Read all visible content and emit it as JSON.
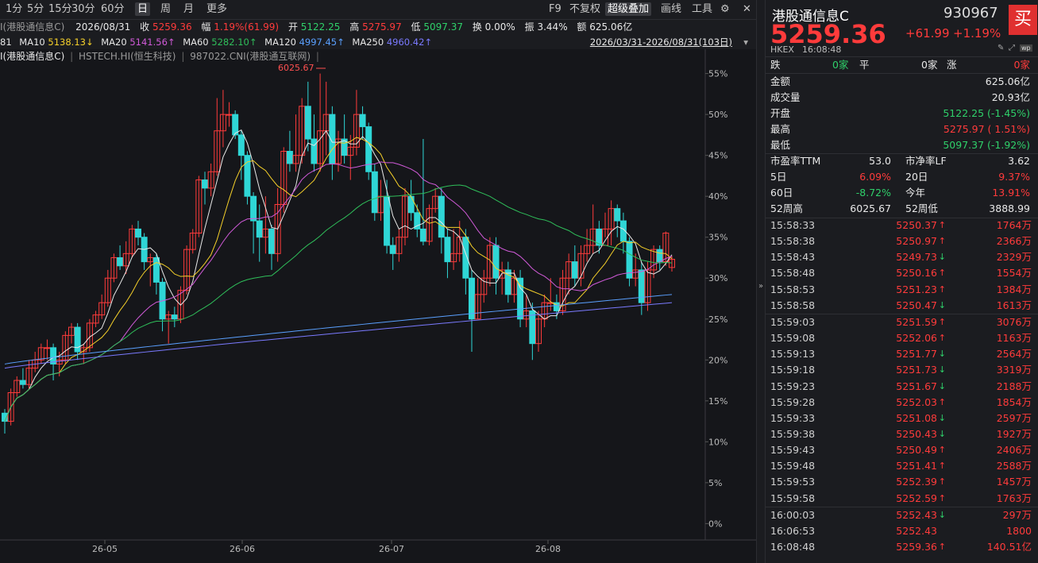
{
  "toolbar": {
    "left": [
      "1分",
      "5分",
      "15分",
      "30分",
      "60分",
      "日",
      "周",
      "月",
      "更多"
    ],
    "active_index": 5,
    "right": [
      "F9",
      "不复权",
      "超级叠加",
      "画线",
      "工具"
    ],
    "right_active_index": 2
  },
  "info": {
    "date": "2026/08/31",
    "close_label": "收",
    "close": "5259.36",
    "amp_label": "幅",
    "amp": "1.19%(61.99)",
    "open_label": "开",
    "open": "5122.25",
    "high_label": "高",
    "high": "5275.97",
    "low_label": "低",
    "low": "5097.37",
    "turnover_label": "换",
    "turnover": "0.00%",
    "swing_label": "振",
    "swing": "3.44%",
    "amount_label": "额",
    "amount": "625.06亿",
    "title_fragment": "I(港股通信息C)"
  },
  "ma": {
    "ma5_frag": "81",
    "ma10_label": "MA10",
    "ma10": "5138.13",
    "ma20_label": "MA20",
    "ma20": "5141.56",
    "ma60_label": "MA60",
    "ma60": "5282.10",
    "ma120_label": "MA120",
    "ma120": "4997.45",
    "ma250_label": "MA250",
    "ma250": "4960.42",
    "range": "2026/03/31-2026/08/31(103日)"
  },
  "overlay": {
    "main": "I(港股通信息C)",
    "s2": "HSTECH.HI(恒生科技)",
    "s3": "987022.CNI(港股通互联网)"
  },
  "colors": {
    "up": "#ff3b3b",
    "down": "#2fd6d6",
    "ma5": "#e8e8e8",
    "ma10": "#f5d02a",
    "ma20": "#d05ad8",
    "ma60": "#2fbf5a",
    "ma120": "#5aa0ff",
    "ma250": "#7a7aff"
  },
  "chart_data": {
    "type": "candlestick",
    "peak_label": "6025.67",
    "y_ticks": [
      "55%",
      "50%",
      "45%",
      "40%",
      "35%",
      "30%",
      "25%",
      "20%",
      "15%",
      "10%",
      "5%",
      "0%"
    ],
    "x_ticks": [
      "26-05",
      "26-06",
      "26-07",
      "26-08"
    ],
    "candles": [
      [
        0.135,
        0.125,
        0.14,
        0.11
      ],
      [
        0.125,
        0.16,
        0.165,
        0.12
      ],
      [
        0.16,
        0.175,
        0.18,
        0.155
      ],
      [
        0.175,
        0.17,
        0.19,
        0.165
      ],
      [
        0.17,
        0.19,
        0.2,
        0.165
      ],
      [
        0.19,
        0.2,
        0.21,
        0.185
      ],
      [
        0.2,
        0.215,
        0.22,
        0.195
      ],
      [
        0.215,
        0.215,
        0.225,
        0.2
      ],
      [
        0.215,
        0.195,
        0.22,
        0.175
      ],
      [
        0.195,
        0.2,
        0.21,
        0.18
      ],
      [
        0.2,
        0.23,
        0.235,
        0.195
      ],
      [
        0.23,
        0.24,
        0.245,
        0.22
      ],
      [
        0.24,
        0.21,
        0.245,
        0.2
      ],
      [
        0.21,
        0.215,
        0.22,
        0.195
      ],
      [
        0.215,
        0.245,
        0.25,
        0.21
      ],
      [
        0.245,
        0.255,
        0.26,
        0.24
      ],
      [
        0.255,
        0.27,
        0.28,
        0.25
      ],
      [
        0.27,
        0.3,
        0.31,
        0.265
      ],
      [
        0.3,
        0.325,
        0.33,
        0.295
      ],
      [
        0.325,
        0.315,
        0.34,
        0.31
      ],
      [
        0.315,
        0.33,
        0.345,
        0.305
      ],
      [
        0.33,
        0.36,
        0.365,
        0.325
      ],
      [
        0.36,
        0.35,
        0.37,
        0.34
      ],
      [
        0.35,
        0.32,
        0.355,
        0.31
      ],
      [
        0.32,
        0.325,
        0.33,
        0.29
      ],
      [
        0.325,
        0.295,
        0.33,
        0.28
      ],
      [
        0.295,
        0.25,
        0.3,
        0.235
      ],
      [
        0.25,
        0.255,
        0.26,
        0.22
      ],
      [
        0.255,
        0.25,
        0.265,
        0.24
      ],
      [
        0.25,
        0.285,
        0.29,
        0.245
      ],
      [
        0.285,
        0.335,
        0.34,
        0.28
      ],
      [
        0.335,
        0.355,
        0.36,
        0.33
      ],
      [
        0.355,
        0.42,
        0.425,
        0.35
      ],
      [
        0.42,
        0.41,
        0.43,
        0.39
      ],
      [
        0.41,
        0.43,
        0.44,
        0.4
      ],
      [
        0.43,
        0.48,
        0.52,
        0.425
      ],
      [
        0.48,
        0.5,
        0.53,
        0.46
      ],
      [
        0.5,
        0.5,
        0.515,
        0.485
      ],
      [
        0.5,
        0.475,
        0.505,
        0.47
      ],
      [
        0.475,
        0.45,
        0.48,
        0.42
      ],
      [
        0.45,
        0.4,
        0.455,
        0.39
      ],
      [
        0.4,
        0.37,
        0.405,
        0.33
      ],
      [
        0.37,
        0.35,
        0.39,
        0.32
      ],
      [
        0.35,
        0.36,
        0.4,
        0.33
      ],
      [
        0.36,
        0.33,
        0.365,
        0.31
      ],
      [
        0.33,
        0.39,
        0.41,
        0.32
      ],
      [
        0.39,
        0.455,
        0.46,
        0.38
      ],
      [
        0.455,
        0.44,
        0.48,
        0.43
      ],
      [
        0.44,
        0.45,
        0.5,
        0.43
      ],
      [
        0.45,
        0.51,
        0.52,
        0.44
      ],
      [
        0.51,
        0.47,
        0.54,
        0.455
      ],
      [
        0.47,
        0.44,
        0.5,
        0.43
      ],
      [
        0.44,
        0.48,
        0.55,
        0.43
      ],
      [
        0.48,
        0.5,
        0.54,
        0.45
      ],
      [
        0.5,
        0.44,
        0.51,
        0.42
      ],
      [
        0.44,
        0.47,
        0.48,
        0.43
      ],
      [
        0.47,
        0.45,
        0.5,
        0.44
      ],
      [
        0.45,
        0.46,
        0.475,
        0.42
      ],
      [
        0.46,
        0.5,
        0.53,
        0.45
      ],
      [
        0.5,
        0.485,
        0.51,
        0.47
      ],
      [
        0.485,
        0.43,
        0.49,
        0.42
      ],
      [
        0.43,
        0.38,
        0.44,
        0.37
      ],
      [
        0.38,
        0.4,
        0.42,
        0.37
      ],
      [
        0.4,
        0.34,
        0.42,
        0.33
      ],
      [
        0.34,
        0.33,
        0.35,
        0.31
      ],
      [
        0.33,
        0.35,
        0.36,
        0.32
      ],
      [
        0.35,
        0.4,
        0.41,
        0.34
      ],
      [
        0.4,
        0.38,
        0.42,
        0.37
      ],
      [
        0.38,
        0.36,
        0.39,
        0.35
      ],
      [
        0.36,
        0.345,
        0.47,
        0.34
      ],
      [
        0.345,
        0.385,
        0.39,
        0.34
      ],
      [
        0.385,
        0.4,
        0.41,
        0.38
      ],
      [
        0.4,
        0.35,
        0.41,
        0.33
      ],
      [
        0.35,
        0.32,
        0.36,
        0.3
      ],
      [
        0.32,
        0.33,
        0.36,
        0.31
      ],
      [
        0.33,
        0.35,
        0.37,
        0.32
      ],
      [
        0.35,
        0.3,
        0.36,
        0.28
      ],
      [
        0.3,
        0.25,
        0.31,
        0.21
      ],
      [
        0.25,
        0.28,
        0.3,
        0.25
      ],
      [
        0.28,
        0.3,
        0.31,
        0.27
      ],
      [
        0.3,
        0.34,
        0.35,
        0.29
      ],
      [
        0.34,
        0.3,
        0.35,
        0.28
      ],
      [
        0.3,
        0.31,
        0.32,
        0.28
      ],
      [
        0.31,
        0.28,
        0.32,
        0.27
      ],
      [
        0.28,
        0.3,
        0.31,
        0.27
      ],
      [
        0.3,
        0.25,
        0.31,
        0.24
      ],
      [
        0.25,
        0.26,
        0.28,
        0.24
      ],
      [
        0.26,
        0.22,
        0.27,
        0.2
      ],
      [
        0.22,
        0.25,
        0.26,
        0.21
      ],
      [
        0.25,
        0.27,
        0.28,
        0.24
      ],
      [
        0.27,
        0.27,
        0.3,
        0.26
      ],
      [
        0.27,
        0.26,
        0.28,
        0.25
      ],
      [
        0.26,
        0.3,
        0.31,
        0.255
      ],
      [
        0.3,
        0.32,
        0.33,
        0.28
      ],
      [
        0.32,
        0.3,
        0.34,
        0.29
      ],
      [
        0.3,
        0.33,
        0.34,
        0.29
      ],
      [
        0.33,
        0.34,
        0.36,
        0.32
      ],
      [
        0.34,
        0.36,
        0.39,
        0.33
      ],
      [
        0.36,
        0.34,
        0.37,
        0.33
      ],
      [
        0.34,
        0.36,
        0.38,
        0.35
      ],
      [
        0.36,
        0.385,
        0.395,
        0.34
      ],
      [
        0.385,
        0.37,
        0.39,
        0.35
      ],
      [
        0.37,
        0.345,
        0.38,
        0.33
      ],
      [
        0.345,
        0.3,
        0.35,
        0.29
      ],
      [
        0.3,
        0.31,
        0.33,
        0.29
      ],
      [
        0.31,
        0.27,
        0.32,
        0.255
      ],
      [
        0.27,
        0.31,
        0.32,
        0.26
      ],
      [
        0.31,
        0.335,
        0.34,
        0.3
      ],
      [
        0.335,
        0.32,
        0.34,
        0.31
      ],
      [
        0.32,
        0.355,
        0.357,
        0.315
      ],
      [
        0.313,
        0.323,
        0.327,
        0.308
      ]
    ],
    "y_range_pct": [
      -0.02,
      0.57
    ]
  },
  "quote": {
    "name": "港股通信息C",
    "code": "930967",
    "price": "5259.36",
    "change": "+61.99",
    "change_pct": "+1.19%",
    "buy_label": "买",
    "exchange": "HKEX",
    "time": "16:08:48",
    "breadth": {
      "down_label": "跌",
      "down": "0家",
      "flat_label": "平",
      "flat": "0家",
      "up_label": "涨",
      "up": "0家"
    },
    "stats": [
      {
        "label": "金额",
        "value": "625.06亿",
        "cls": "white"
      },
      {
        "label": "成交量",
        "value": "20.93亿",
        "cls": "white"
      },
      {
        "label": "开盘",
        "value": "5122.25 (-1.45%)",
        "cls": "green"
      },
      {
        "label": "最高",
        "value": "5275.97 ( 1.51%)",
        "cls": "red"
      },
      {
        "label": "最低",
        "value": "5097.37 (-1.92%)",
        "cls": "green"
      }
    ],
    "pe_label": "市盈率TTM",
    "pe": "53.0",
    "pb_label": "市净率LF",
    "pb": "3.62",
    "d5_label": "5日",
    "d5": "6.09%",
    "d20_label": "20日",
    "d20": "9.37%",
    "d60_label": "60日",
    "d60": "-8.72%",
    "ytd_label": "今年",
    "ytd": "13.91%",
    "w52h_label": "52周高",
    "w52h": "6025.67",
    "w52l_label": "52周低",
    "w52l": "3888.99"
  },
  "ticks": [
    {
      "time": "15:58:33",
      "price": "5250.37",
      "dir": "up",
      "vol": "1764万"
    },
    {
      "time": "15:58:38",
      "price": "5250.97",
      "dir": "up",
      "vol": "2366万"
    },
    {
      "time": "15:58:43",
      "price": "5249.73",
      "dir": "down",
      "vol": "2329万"
    },
    {
      "time": "15:58:48",
      "price": "5250.16",
      "dir": "up",
      "vol": "1554万"
    },
    {
      "time": "15:58:53",
      "price": "5251.23",
      "dir": "up",
      "vol": "1384万"
    },
    {
      "time": "15:58:58",
      "price": "5250.47",
      "dir": "down",
      "vol": "1613万"
    },
    {
      "time": "15:59:03",
      "price": "5251.59",
      "dir": "up",
      "vol": "3076万"
    },
    {
      "time": "15:59:08",
      "price": "5252.06",
      "dir": "up",
      "vol": "1163万"
    },
    {
      "time": "15:59:13",
      "price": "5251.77",
      "dir": "down",
      "vol": "2564万"
    },
    {
      "time": "15:59:18",
      "price": "5251.73",
      "dir": "down",
      "vol": "3319万"
    },
    {
      "time": "15:59:23",
      "price": "5251.67",
      "dir": "down",
      "vol": "2188万"
    },
    {
      "time": "15:59:28",
      "price": "5252.03",
      "dir": "up",
      "vol": "1854万"
    },
    {
      "time": "15:59:33",
      "price": "5251.08",
      "dir": "down",
      "vol": "2597万"
    },
    {
      "time": "15:59:38",
      "price": "5250.43",
      "dir": "down",
      "vol": "1927万"
    },
    {
      "time": "15:59:43",
      "price": "5250.49",
      "dir": "up",
      "vol": "2406万"
    },
    {
      "time": "15:59:48",
      "price": "5251.41",
      "dir": "up",
      "vol": "2588万"
    },
    {
      "time": "15:59:53",
      "price": "5252.39",
      "dir": "up",
      "vol": "1457万"
    },
    {
      "time": "15:59:58",
      "price": "5252.59",
      "dir": "up",
      "vol": "1763万"
    },
    {
      "time": "16:00:03",
      "price": "5252.43",
      "dir": "down",
      "vol": "297万"
    },
    {
      "time": "16:06:53",
      "price": "5252.43",
      "dir": "none",
      "vol": "1800"
    },
    {
      "time": "16:08:48",
      "price": "5259.36",
      "dir": "up",
      "vol": "140.51亿"
    }
  ]
}
